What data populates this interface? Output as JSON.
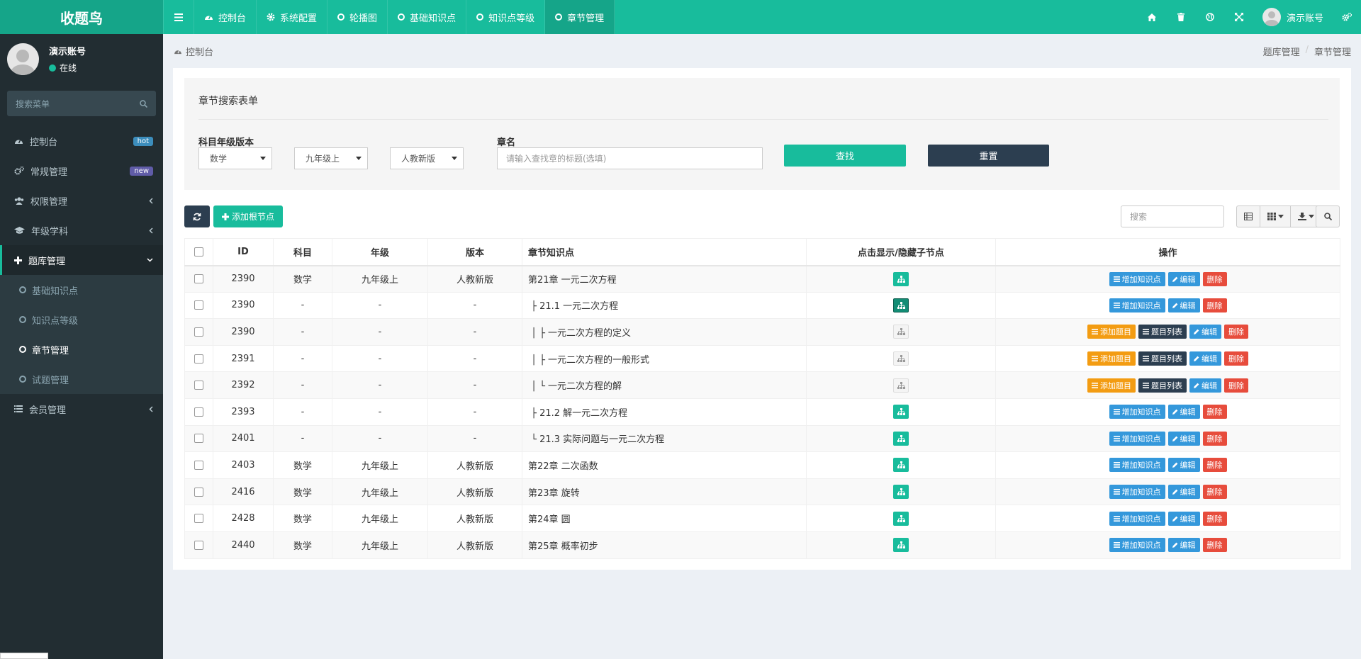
{
  "app": {
    "logo": "收题鸟"
  },
  "topnav": {
    "tabs": [
      {
        "label": "控制台",
        "icon": "dashboard-icon"
      },
      {
        "label": "系统配置",
        "icon": "gear-icon"
      },
      {
        "label": "轮播图",
        "icon": "ring-icon"
      },
      {
        "label": "基础知识点",
        "icon": "ring-icon"
      },
      {
        "label": "知识点等级",
        "icon": "ring-icon"
      },
      {
        "label": "章节管理",
        "icon": "ring-icon",
        "active": true
      }
    ],
    "user": "演示账号"
  },
  "sidebar": {
    "user": {
      "name": "演示账号",
      "status": "在线"
    },
    "search_placeholder": "搜索菜单",
    "menu": [
      {
        "label": "控制台",
        "badge": "hot"
      },
      {
        "label": "常规管理",
        "badge": "new"
      },
      {
        "label": "权限管理"
      },
      {
        "label": "年级学科"
      },
      {
        "label": "题库管理"
      },
      {
        "label": "会员管理"
      }
    ],
    "submenu": [
      "基础知识点",
      "知识点等级",
      "章节管理",
      "试题管理"
    ]
  },
  "content": {
    "header_left": "控制台",
    "breadcrumb": [
      "题库管理",
      "章节管理"
    ]
  },
  "search_form": {
    "title": "章节搜索表单",
    "label_version": "科目年级版本",
    "subject": "数学",
    "grade": "九年级上",
    "edition": "人教新版",
    "label_chapter": "章名",
    "chapter_placeholder": "请输入查找章的标题(选填)",
    "find_label": "查找",
    "reset_label": "重置"
  },
  "toolbar": {
    "add_label": "添加根节点",
    "search_placeholder": "搜索"
  },
  "table": {
    "columns": [
      "ID",
      "科目",
      "年级",
      "版本",
      "章节知识点",
      "点击显示/隐藏子节点",
      "操作"
    ],
    "rows": [
      {
        "id": "2390",
        "subject": "数学",
        "grade": "九年级上",
        "edition": "人教新版",
        "title": "第21章 一元二次方程",
        "tree": "green",
        "ops": "node"
      },
      {
        "id": "2390",
        "subject": "-",
        "grade": "-",
        "edition": "-",
        "title": " ├ 21.1 一元二次方程",
        "tree": "dark",
        "ops": "node"
      },
      {
        "id": "2390",
        "subject": "-",
        "grade": "-",
        "edition": "-",
        "title": " │ ├ 一元二次方程的定义",
        "tree": "light",
        "ops": "leaf"
      },
      {
        "id": "2391",
        "subject": "-",
        "grade": "-",
        "edition": "-",
        "title": " │ ├ 一元二次方程的一般形式",
        "tree": "light",
        "ops": "leaf"
      },
      {
        "id": "2392",
        "subject": "-",
        "grade": "-",
        "edition": "-",
        "title": " │ └ 一元二次方程的解",
        "tree": "light",
        "ops": "leaf"
      },
      {
        "id": "2393",
        "subject": "-",
        "grade": "-",
        "edition": "-",
        "title": " ├ 21.2 解一元二次方程",
        "tree": "green",
        "ops": "node"
      },
      {
        "id": "2401",
        "subject": "-",
        "grade": "-",
        "edition": "-",
        "title": " └ 21.3 实际问题与一元二次方程",
        "tree": "green",
        "ops": "node"
      },
      {
        "id": "2403",
        "subject": "数学",
        "grade": "九年级上",
        "edition": "人教新版",
        "title": "第22章 二次函数",
        "tree": "green",
        "ops": "node"
      },
      {
        "id": "2416",
        "subject": "数学",
        "grade": "九年级上",
        "edition": "人教新版",
        "title": "第23章 旋转",
        "tree": "green",
        "ops": "node"
      },
      {
        "id": "2428",
        "subject": "数学",
        "grade": "九年级上",
        "edition": "人教新版",
        "title": "第24章 圆",
        "tree": "green",
        "ops": "node"
      },
      {
        "id": "2440",
        "subject": "数学",
        "grade": "九年级上",
        "edition": "人教新版",
        "title": "第25章 概率初步",
        "tree": "green",
        "ops": "node"
      }
    ],
    "op_labels": {
      "add_point": "增加知识点",
      "edit": "编辑",
      "delete": "删除",
      "add_question": "添加题目",
      "question_list": "题目列表"
    }
  },
  "colors": {
    "brand": "#18bc9c",
    "sidebar": "#222d32",
    "dark_btn": "#2c3e50",
    "blue": "#3498db",
    "red": "#e74c3c",
    "orange": "#f39c12"
  }
}
